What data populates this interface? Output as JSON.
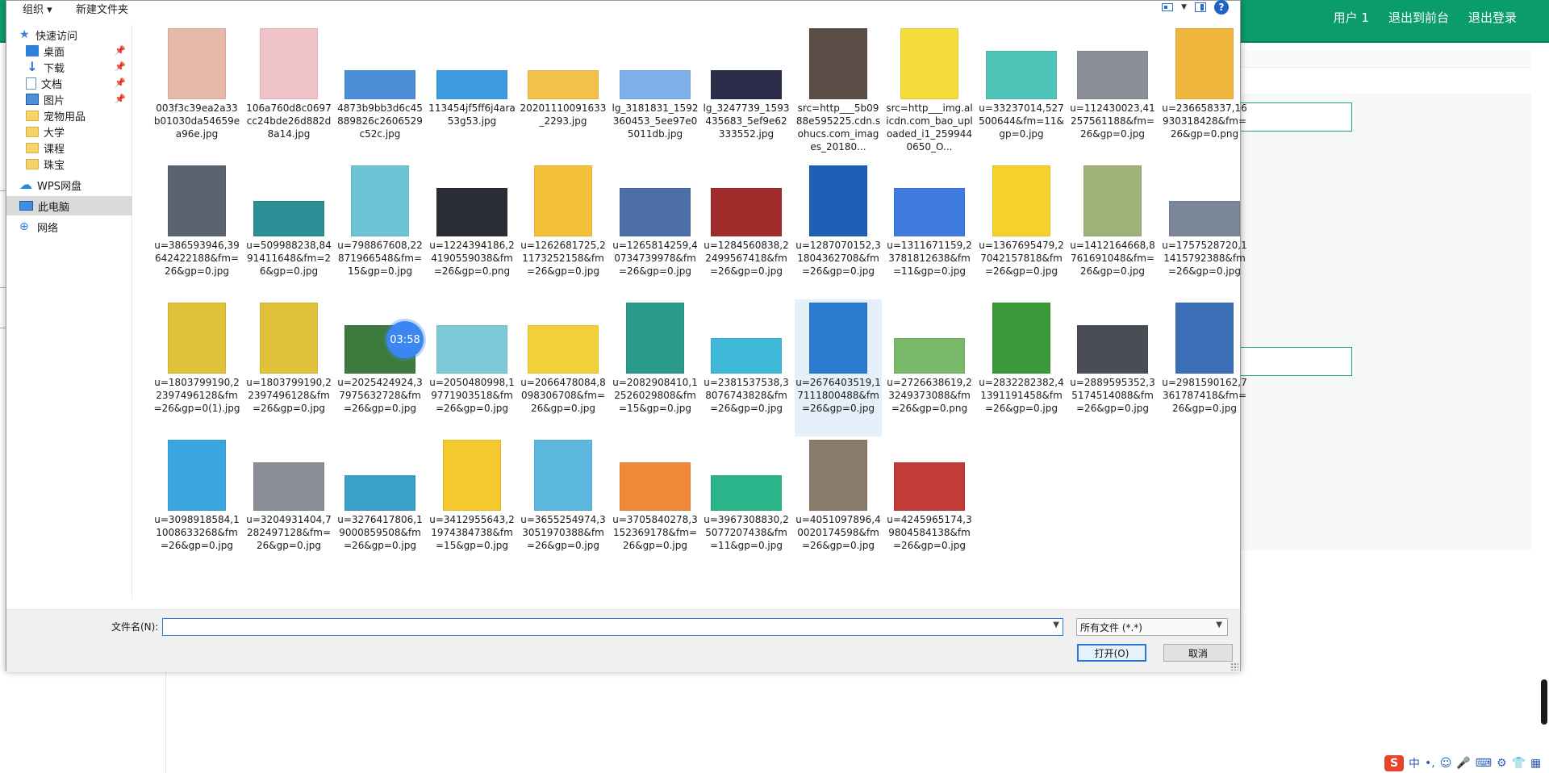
{
  "background_page": {
    "nav": [
      "用户 1",
      "退出到前台",
      "退出登录"
    ],
    "accent_color": "#0a9d6a"
  },
  "dialog": {
    "toolbar": {
      "organize": "组织 ▾",
      "new_folder": "新建文件夹",
      "help": "?"
    },
    "nav": [
      {
        "label": "快速访问",
        "icon": "star-icon",
        "pinned": false
      },
      {
        "label": "桌面",
        "icon": "desktop-icon",
        "pinned": true
      },
      {
        "label": "下载",
        "icon": "download-icon",
        "pinned": true
      },
      {
        "label": "文档",
        "icon": "document-icon",
        "pinned": true
      },
      {
        "label": "图片",
        "icon": "pictures-icon",
        "pinned": true
      },
      {
        "label": "宠物用品",
        "icon": "folder-icon",
        "pinned": false
      },
      {
        "label": "大学",
        "icon": "folder-icon",
        "pinned": false
      },
      {
        "label": "课程",
        "icon": "folder-icon",
        "pinned": false
      },
      {
        "label": "珠宝",
        "icon": "folder-icon",
        "pinned": false
      },
      {
        "label": "WPS网盘",
        "icon": "cloud-icon",
        "pinned": false
      },
      {
        "label": "此电脑",
        "icon": "computer-icon",
        "pinned": false
      },
      {
        "label": "网络",
        "icon": "network-icon",
        "pinned": false
      }
    ],
    "files": [
      {
        "name": "003f3c39ea2a33b01030da54659ea96e.jpg",
        "color": "#e7b9a8",
        "shape": "tall"
      },
      {
        "name": "106a760d8c0697cc24bde26d882d8a14.jpg",
        "color": "#f0c3c8",
        "shape": "tall"
      },
      {
        "name": "4873b9bb3d6c45889826c2606529c52c.jpg",
        "color": "#4a8fd8",
        "shape": "wide"
      },
      {
        "name": "113454jf5ff6j4ara53g53.jpg",
        "color": "#3d9be0",
        "shape": "wide"
      },
      {
        "name": "20201110091633_2293.jpg",
        "color": "#f2c14a",
        "shape": "wide"
      },
      {
        "name": "lg_3181831_1592360453_5ee97e05011db.jpg",
        "color": "#7fb0ea",
        "shape": "wide"
      },
      {
        "name": "lg_3247739_1593435683_5ef9e62333552.jpg",
        "color": "#2a2c4a",
        "shape": "wide"
      },
      {
        "name": "src=http___5b0988e595225.cdn.sohucs.com_images_20180...",
        "color": "#5c4e46",
        "shape": "tall"
      },
      {
        "name": "src=http___img.alicdn.com_bao_uploaded_i1_2599440650_O...",
        "color": "#f4dd3a",
        "shape": "tall"
      },
      {
        "name": "u=33237014,527500644&fm=11&gp=0.jpg",
        "color": "#4fc3b7",
        "shape": "mid"
      },
      {
        "name": "u=112430023,41257561188&fm=26&gp=0.jpg",
        "color": "#8b8f97",
        "shape": "mid"
      },
      {
        "name": "u=236658337,16930318428&fm=26&gp=0.png",
        "color": "#f0b53c",
        "shape": "tall"
      },
      {
        "name": "u=386593946,39642422188&fm=26&gp=0.jpg",
        "color": "#5a6470",
        "shape": "tall"
      },
      {
        "name": "u=509988238,8491411648&fm=26&gp=0.jpg",
        "color": "#2b8f95",
        "shape": "short"
      },
      {
        "name": "u=798867608,22871966548&fm=15&gp=0.jpg",
        "color": "#6cc3d6",
        "shape": "tall"
      },
      {
        "name": "u=1224394186,24190559038&fm=26&gp=0.png",
        "color": "#2a2d33",
        "shape": "mid"
      },
      {
        "name": "u=1262681725,21173252158&fm=26&gp=0.jpg",
        "color": "#f3c13a",
        "shape": "tall"
      },
      {
        "name": "u=1265814259,40734739978&fm=26&gp=0.jpg",
        "color": "#4c6fa8",
        "shape": "mid"
      },
      {
        "name": "u=1284560838,22499567418&fm=26&gp=0.jpg",
        "color": "#a12a2a",
        "shape": "mid"
      },
      {
        "name": "u=1287070152,31804362708&fm=26&gp=0.jpg",
        "color": "#1e5fb8",
        "shape": "tall"
      },
      {
        "name": "u=1311671159,23781812638&fm=11&gp=0.jpg",
        "color": "#3f7be0",
        "shape": "mid"
      },
      {
        "name": "u=1367695479,27042157818&fm=26&gp=0.jpg",
        "color": "#f6d12e",
        "shape": "tall"
      },
      {
        "name": "u=1412164668,8761691048&fm=26&gp=0.jpg",
        "color": "#9fb27a",
        "shape": "tall"
      },
      {
        "name": "u=1757528720,11415792388&fm=26&gp=0.jpg",
        "color": "#7a8796",
        "shape": "short"
      },
      {
        "name": "u=1803799190,22397496128&fm=26&gp=0(1).jpg",
        "color": "#e0c23a",
        "shape": "tall"
      },
      {
        "name": "u=1803799190,22397496128&fm=26&gp=0.jpg",
        "color": "#e0c23a",
        "shape": "tall"
      },
      {
        "name": "u=2025424924,37975632728&fm=26&gp=0.jpg",
        "color": "#3d7a3d",
        "shape": "mid"
      },
      {
        "name": "u=2050480998,19771903518&fm=26&gp=0.jpg",
        "color": "#7ec9d9",
        "shape": "mid"
      },
      {
        "name": "u=2066478084,8098306708&fm=26&gp=0.jpg",
        "color": "#f2d03a",
        "shape": "mid"
      },
      {
        "name": "u=2082908410,12526029808&fm=15&gp=0.jpg",
        "color": "#2a9a8a",
        "shape": "tall"
      },
      {
        "name": "u=2381537538,38076743828&fm=26&gp=0.jpg",
        "color": "#3db8d8",
        "shape": "short"
      },
      {
        "name": "u=2676403519,17111800488&fm=26&gp=0.jpg",
        "color": "#2a7ad0",
        "shape": "tall"
      },
      {
        "name": "u=2726638619,23249373088&fm=26&gp=0.png",
        "color": "#7ab86a",
        "shape": "short"
      },
      {
        "name": "u=2832282382,41391191458&fm=26&gp=0.jpg",
        "color": "#3a9a3a",
        "shape": "tall"
      },
      {
        "name": "u=2889595352,35174514088&fm=26&gp=0.jpg",
        "color": "#4a4d55",
        "shape": "mid"
      },
      {
        "name": "u=2981590162,7361787418&fm=26&gp=0.jpg",
        "color": "#3b6fb6",
        "shape": "tall"
      },
      {
        "name": "u=3098918584,11008633268&fm=26&gp=0.jpg",
        "color": "#3aa7e0",
        "shape": "tall"
      },
      {
        "name": "u=3204931404,7282497128&fm=26&gp=0.jpg",
        "color": "#8a8f95",
        "shape": "mid"
      },
      {
        "name": "u=3276417806,19000859508&fm=26&gp=0.jpg",
        "color": "#3ba0c8",
        "shape": "short"
      },
      {
        "name": "u=3412955643,21974384738&fm=15&gp=0.jpg",
        "color": "#f5c82e",
        "shape": "tall"
      },
      {
        "name": "u=3655254974,33051970388&fm=26&gp=0.jpg",
        "color": "#5db8e0",
        "shape": "tall"
      },
      {
        "name": "u=3705840278,3152369178&fm=26&gp=0.jpg",
        "color": "#f08a3a",
        "shape": "mid"
      },
      {
        "name": "u=3967308830,25077207438&fm=11&gp=0.jpg",
        "color": "#2bb38a",
        "shape": "short"
      },
      {
        "name": "u=4051097896,40020174598&fm=26&gp=0.jpg",
        "color": "#8a7a6a",
        "shape": "tall"
      },
      {
        "name": "u=4245965174,39804584138&fm=26&gp=0.jpg",
        "color": "#c23a3a",
        "shape": "mid"
      }
    ],
    "hovered_index": 31,
    "overlay_timer": "03:58",
    "bottom": {
      "filename_label": "文件名(N):",
      "filename_value": "",
      "filetype": "所有文件 (*.*)",
      "open_label": "打开(O)",
      "cancel_label": "取消"
    }
  },
  "ime_tray": {
    "logo": "S",
    "mode": "中",
    "punct": "•,"
  }
}
